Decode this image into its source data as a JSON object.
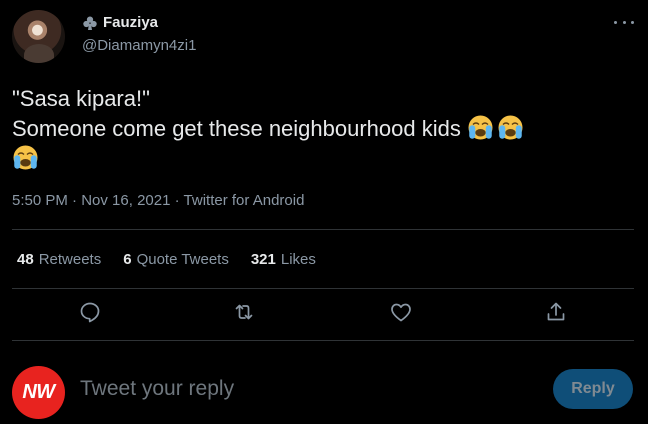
{
  "author": {
    "display_name": "Fauziya",
    "handle": "@Diamamyn4zi1",
    "avatar_icon": "profile-photo",
    "badge_icon": "club-suit-icon"
  },
  "tweet": {
    "line1": "\"Sasa kipara!\"",
    "line2": "Someone come get these neighbourhood kids",
    "emoji_name": "loudly-crying-face",
    "emoji_count": 3
  },
  "meta": {
    "time": "5:50 PM",
    "date": "Nov 16, 2021",
    "source": "Twitter for Android",
    "separator": "·"
  },
  "stats": [
    {
      "count": "48",
      "label": "Retweets"
    },
    {
      "count": "6",
      "label": "Quote Tweets"
    },
    {
      "count": "321",
      "label": "Likes"
    }
  ],
  "actions": [
    "reply-icon",
    "retweet-icon",
    "like-icon",
    "share-icon"
  ],
  "reply": {
    "avatar_text": "NW",
    "placeholder": "Tweet your reply",
    "button_label": "Reply"
  },
  "colors": {
    "background": "#000000",
    "text_primary": "#e7e9ea",
    "text_secondary": "#8b98a5",
    "divider": "#2f3336",
    "reply_button_bg": "#0f4e78",
    "reply_avatar_bg": "#e8231f"
  }
}
